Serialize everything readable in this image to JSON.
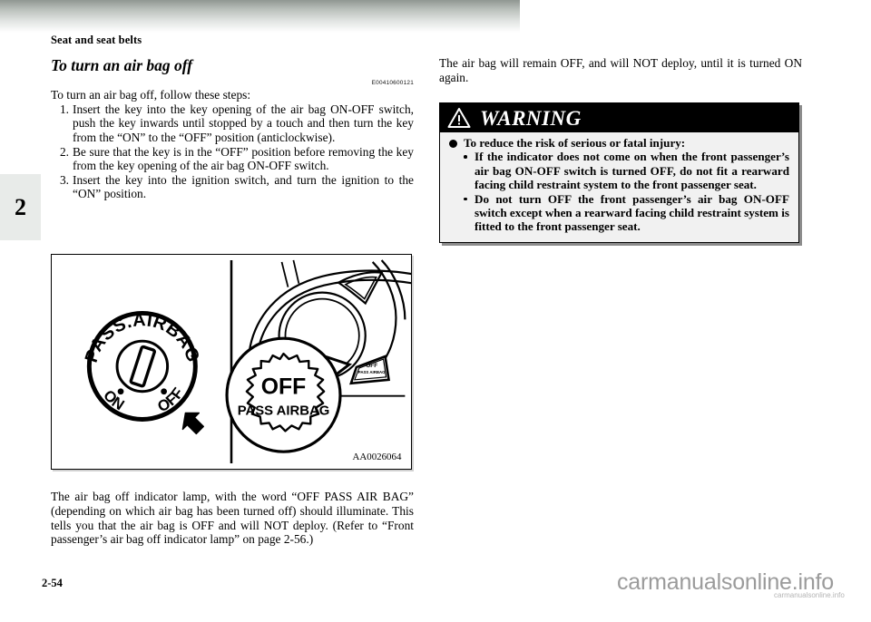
{
  "page": {
    "running_head": "Seat and seat belts",
    "chapter_tab": "2",
    "folio": "2-54",
    "watermark": "carmanualsonline.info",
    "watermark_small": "carmanualsonline.info"
  },
  "left_column": {
    "section_title": "To turn an air bag off",
    "reference_code": "E00410600121",
    "lead_paragraph": "To turn an air bag off, follow these steps:",
    "steps": [
      {
        "number": "1.",
        "text": "Insert the key into the key opening of the air bag ON-OFF switch, push the key inwards until stopped by a touch and then turn the key from the “ON” to the “OFF” position (anticlockwise)."
      },
      {
        "number": "2.",
        "text": "Be sure that the key is in the “OFF” position before removing the key from the key opening of the air bag ON-OFF switch."
      },
      {
        "number": "3.",
        "text": "Insert the key into the ignition switch, and turn the ignition to the “ON” position."
      }
    ],
    "figure": {
      "id": "AA0026064",
      "dial_label_top": "PASS.AIRBAG",
      "dial_label_left": "ON",
      "dial_label_right": "OFF",
      "indicator_big_line1": "OFF",
      "indicator_big_line2": "PASS AIRBAG",
      "indicator_small_line1": "OFF",
      "indicator_small_line2": "PASS AIRBAG"
    },
    "after_figure_paragraph": "The air bag off indicator lamp, with the word “OFF PASS AIR BAG” (depending on which air bag has been turned off) should illuminate. This tells you that the air bag is OFF and will NOT deploy. (Refer to “Front passenger’s air bag off indicator lamp” on page 2-56.)"
  },
  "right_column": {
    "intro_paragraph": "The air bag will remain OFF, and will NOT deploy, until it is turned ON again.",
    "warning": {
      "heading": "WARNING",
      "icon": "warning-triangle-icon",
      "lead": "To reduce the risk of serious or fatal injury:",
      "items": [
        "If the indicator does not come on when the front passenger’s air bag ON-OFF switch is turned OFF, do not fit a rearward facing child restraint system to the front passenger seat.",
        "Do not turn OFF the front passenger’s air bag ON-OFF switch except when a rearward facing child restraint system is fitted to the front passenger seat."
      ]
    }
  },
  "colors": {
    "warning_header_bg": "#000000",
    "warning_body_bg": "#f1f1f1",
    "chapter_tab_bg": "#e8ebe9",
    "watermark": "#9b9b9b"
  }
}
